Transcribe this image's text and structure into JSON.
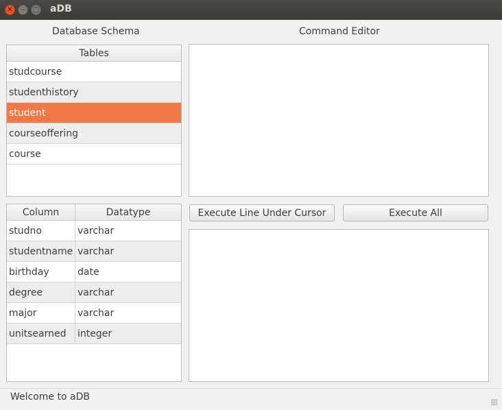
{
  "window": {
    "title": "aDB"
  },
  "schema": {
    "label": "Database Schema"
  },
  "tables": {
    "header": "Tables",
    "items": [
      "studcourse",
      "studenthistory",
      "student",
      "courseoffering",
      "course"
    ],
    "selected_index": 2
  },
  "columns": {
    "headers": [
      "Column",
      "Datatype"
    ],
    "rows": [
      [
        "studno",
        "varchar"
      ],
      [
        "studentname",
        "varchar"
      ],
      [
        "birthday",
        "date"
      ],
      [
        "degree",
        "varchar"
      ],
      [
        "major",
        "varchar"
      ],
      [
        "unitsearned",
        "integer"
      ]
    ]
  },
  "editor": {
    "label": "Command Editor",
    "text": ""
  },
  "buttons": {
    "execute_line": "Execute Line Under Cursor",
    "execute_all": "Execute All"
  },
  "output": {
    "text": ""
  },
  "status": {
    "text": "Welcome to aDB"
  },
  "colors": {
    "accent": "#f07746",
    "close_button": "#e95420",
    "titlebar": "#3c3b37"
  },
  "icons": {
    "close": "close-icon",
    "minimize": "minimize-icon",
    "maximize": "maximize-icon",
    "resize": "resize-grip-icon"
  }
}
